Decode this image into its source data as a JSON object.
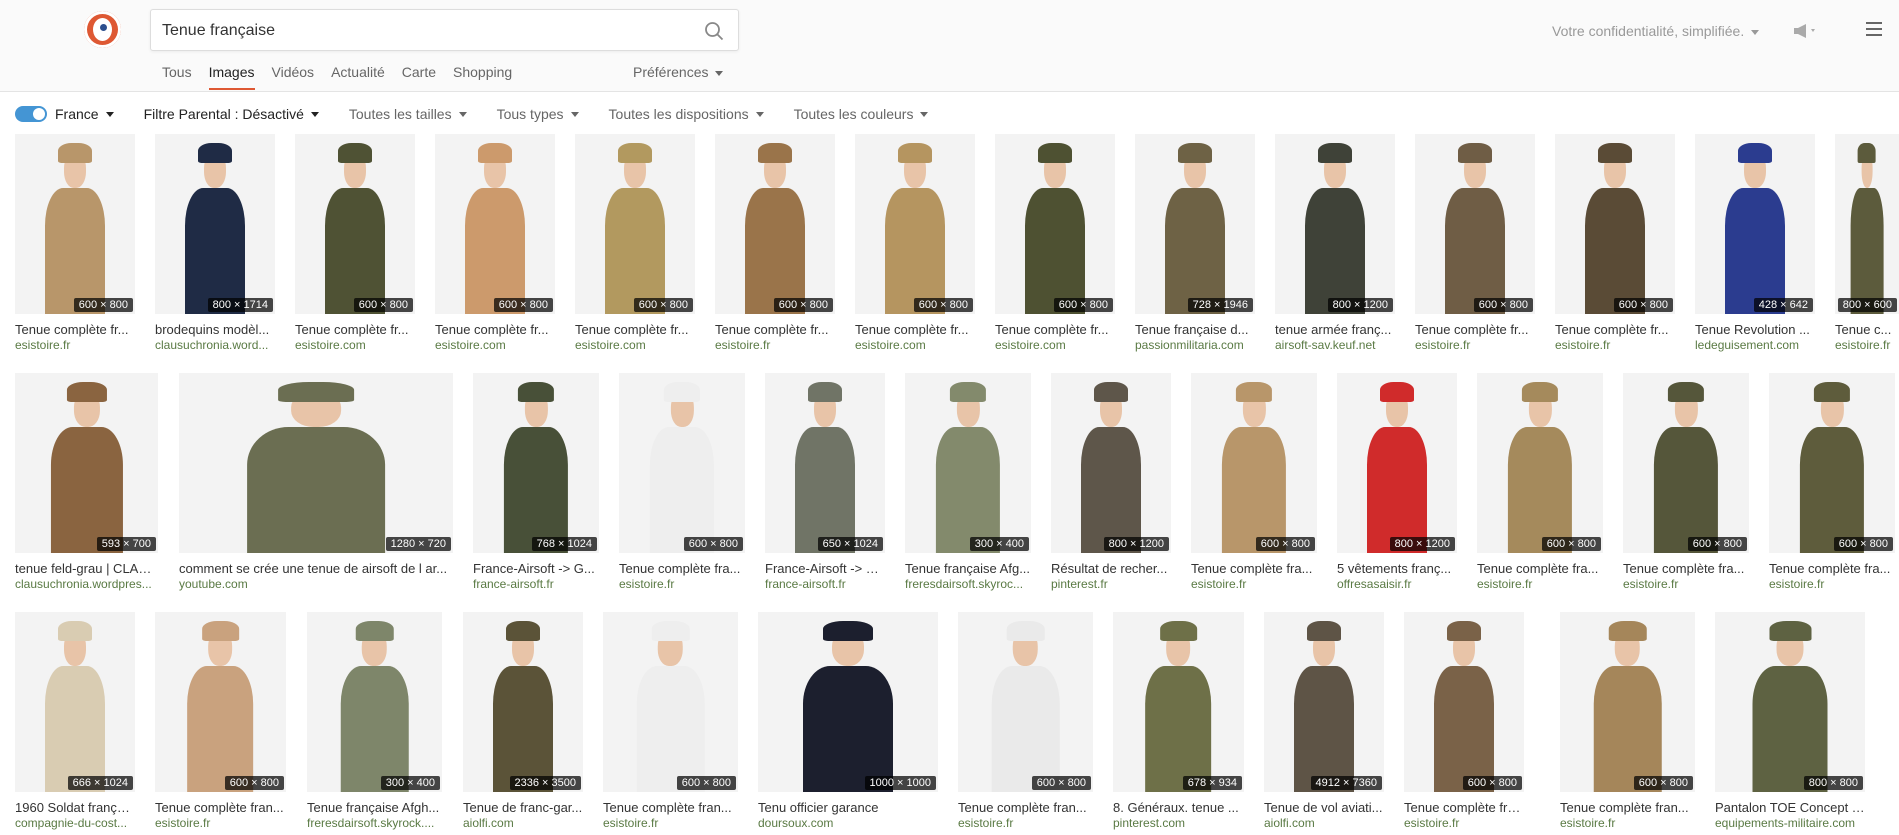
{
  "search": {
    "query": "Tenue française"
  },
  "nav": [
    "Tous",
    "Images",
    "Vidéos",
    "Actualité",
    "Carte",
    "Shopping"
  ],
  "nav_active": "Images",
  "preferences_label": "Préférences",
  "privacy_label": "Votre confidentialité, simplifiée.",
  "filters": {
    "region": "France",
    "parental": "Filtre Parental : Désactivé",
    "sizes": "Toutes les tailles",
    "types": "Tous types",
    "layouts": "Toutes les dispositions",
    "colors": "Toutes les couleurs"
  },
  "colors": {
    "accent": "#de5833",
    "toggle": "#4495d4",
    "domain": "#5a7a44"
  },
  "rows": [
    [
      {
        "title": "Tenue complète fr...",
        "domain": "esistoire.fr",
        "dim": "600 × 800",
        "c": "#b8966a"
      },
      {
        "title": "brodequins modèl...",
        "domain": "clausuchronia.word...",
        "dim": "800 × 1714",
        "c": "#1f2b45"
      },
      {
        "title": "Tenue complète fr...",
        "domain": "esistoire.com",
        "dim": "600 × 800",
        "c": "#4f5234"
      },
      {
        "title": "Tenue complète fr...",
        "domain": "esistoire.com",
        "dim": "600 × 800",
        "c": "#cc9a6c"
      },
      {
        "title": "Tenue complète fr...",
        "domain": "esistoire.com",
        "dim": "600 × 800",
        "c": "#b2995f"
      },
      {
        "title": "Tenue complète fr...",
        "domain": "esistoire.fr",
        "dim": "600 × 800",
        "c": "#9a744a"
      },
      {
        "title": "Tenue complète fr...",
        "domain": "esistoire.com",
        "dim": "600 × 800",
        "c": "#b59560"
      },
      {
        "title": "Tenue complète fr...",
        "domain": "esistoire.com",
        "dim": "600 × 800",
        "c": "#4e5132"
      },
      {
        "title": "Tenue française d...",
        "domain": "passionmilitaria.com",
        "dim": "728 × 1946",
        "c": "#6e6245"
      },
      {
        "title": "tenue armée franç...",
        "domain": "airsoft-sav.keuf.net",
        "dim": "800 × 1200",
        "c": "#3f4238"
      },
      {
        "title": "Tenue complète fr...",
        "domain": "esistoire.fr",
        "dim": "600 × 800",
        "c": "#6f5d45"
      },
      {
        "title": "Tenue complète fr...",
        "domain": "esistoire.fr",
        "dim": "600 × 800",
        "c": "#5a4b36"
      },
      {
        "title": "Tenue Revolution ...",
        "domain": "ledeguisement.com",
        "dim": "428 × 642",
        "c": "#2b3c8f"
      },
      {
        "title": "Tenue c...",
        "domain": "esistoire.fr",
        "dim": "800 × 600",
        "c": "#5c5b3c"
      }
    ],
    [
      {
        "title": "tenue feld-grau | CLAU...",
        "domain": "clausuchronia.wordpres...",
        "dim": "593 × 700",
        "c": "#8a6440"
      },
      {
        "title": "comment se crée une tenue de airsoft de l ar...",
        "domain": "youtube.com",
        "dim": "1280 × 720",
        "c": "#6b6e52"
      },
      {
        "title": "France-Airsoft -> G...",
        "domain": "france-airsoft.fr",
        "dim": "768 × 1024",
        "c": "#485038"
      },
      {
        "title": "Tenue complète fra...",
        "domain": "esistoire.fr",
        "dim": "600 × 800",
        "c": "#eeeeee"
      },
      {
        "title": "France-Airsoft -> G...",
        "domain": "france-airsoft.fr",
        "dim": "650 × 1024",
        "c": "#707466"
      },
      {
        "title": "Tenue française Afg...",
        "domain": "freresdairsoft.skyroc...",
        "dim": "300 × 400",
        "c": "#838a6c"
      },
      {
        "title": "Résultat de recher...",
        "domain": "pinterest.fr",
        "dim": "800 × 1200",
        "c": "#5e564a"
      },
      {
        "title": "Tenue complète fra...",
        "domain": "esistoire.fr",
        "dim": "600 × 800",
        "c": "#b8966a"
      },
      {
        "title": "5 vêtements franç...",
        "domain": "offresasaisir.fr",
        "dim": "800 × 1200",
        "c": "#d02b2b"
      },
      {
        "title": "Tenue complète fra...",
        "domain": "esistoire.fr",
        "dim": "600 × 800",
        "c": "#a58a5c"
      },
      {
        "title": "Tenue complète fra...",
        "domain": "esistoire.fr",
        "dim": "600 × 800",
        "c": "#55563a"
      },
      {
        "title": "Tenue complète fra...",
        "domain": "esistoire.fr",
        "dim": "600 × 800",
        "c": "#5e5c3c"
      }
    ],
    [
      {
        "title": "1960 Soldat françai...",
        "domain": "compagnie-du-cost...",
        "dim": "666 × 1024",
        "c": "#d9ccb2"
      },
      {
        "title": "Tenue complète fran...",
        "domain": "esistoire.fr",
        "dim": "600 × 800",
        "c": "#c9a27e"
      },
      {
        "title": "Tenue française Afgh...",
        "domain": "freresdairsoft.skyrock....",
        "dim": "300 × 400",
        "c": "#7e866a"
      },
      {
        "title": "Tenue de franc-gar...",
        "domain": "aiolfi.com",
        "dim": "2336 × 3500",
        "c": "#5b5338"
      },
      {
        "title": "Tenue complète fran...",
        "domain": "esistoire.fr",
        "dim": "600 × 800",
        "c": "#eeeeee"
      },
      {
        "title": "Tenu officier garance",
        "domain": "doursoux.com",
        "dim": "1000 × 1000",
        "c": "#1c1f2e"
      },
      {
        "title": "Tenue complète fran...",
        "domain": "esistoire.fr",
        "dim": "600 × 800",
        "c": "#eaeaea"
      },
      {
        "title": "8. Généraux. tenue ...",
        "domain": "pinterest.com",
        "dim": "678 × 934",
        "c": "#6e7048"
      },
      {
        "title": "Tenue de vol aviati...",
        "domain": "aiolfi.com",
        "dim": "4912 × 7360",
        "c": "#5e5446"
      },
      {
        "title": "Tenue complète fran...",
        "domain": "esistoire.fr",
        "dim": "600 × 800",
        "c": "#7a6248"
      },
      {
        "title": "Tenue complète fran...",
        "domain": "esistoire.fr",
        "dim": "600 × 800",
        "c": "#a5865a"
      },
      {
        "title": "Pantalon TOE Concept Treilli...",
        "domain": "equipements-militaire.com",
        "dim": "800 × 800",
        "c": "#5e6242"
      }
    ]
  ]
}
